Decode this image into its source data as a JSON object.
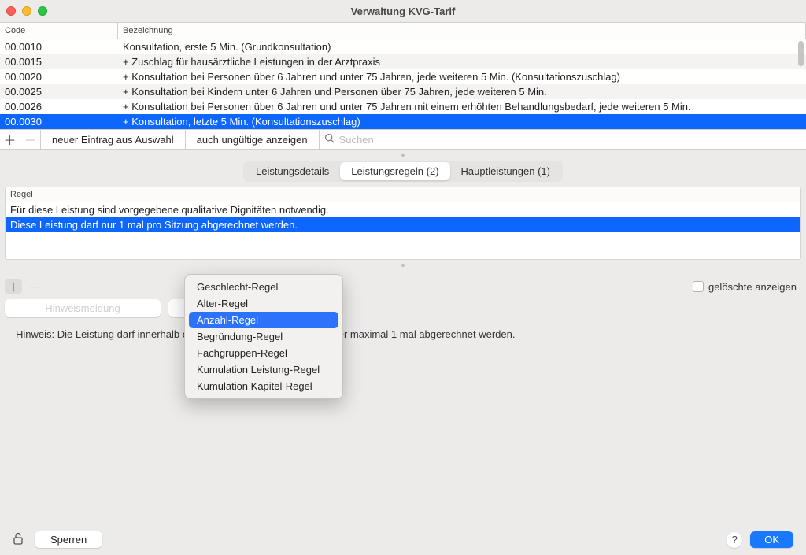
{
  "window": {
    "title": "Verwaltung KVG-Tarif"
  },
  "table": {
    "headers": {
      "code": "Code",
      "desc": "Bezeichnung"
    },
    "rows": [
      {
        "code": "00.0010",
        "desc": "Konsultation, erste 5 Min. (Grundkonsultation)"
      },
      {
        "code": "00.0015",
        "desc": "+ Zuschlag für hausärztliche Leistungen in der Arztpraxis"
      },
      {
        "code": "00.0020",
        "desc": "+ Konsultation bei Personen über 6 Jahren und unter 75 Jahren, jede weiteren 5 Min. (Konsultationszuschlag)"
      },
      {
        "code": "00.0025",
        "desc": "+ Konsultation bei Kindern unter 6 Jahren und Personen über 75 Jahren, jede weiteren 5 Min."
      },
      {
        "code": "00.0026",
        "desc": "+ Konsultation bei Personen über 6 Jahren und unter 75 Jahren mit einem erhöhten Behandlungsbedarf, jede weiteren 5 Min."
      },
      {
        "code": "00.0030",
        "desc": "+ Konsultation, letzte 5 Min. (Konsultationszuschlag)"
      }
    ],
    "selected_index": 5
  },
  "actionbar": {
    "new_from_selection": "neuer Eintrag aus Auswahl",
    "show_invalid": "auch ungültige anzeigen",
    "search_placeholder": "Suchen"
  },
  "tabs": {
    "details": "Leistungsdetails",
    "rules": "Leistungsregeln (2)",
    "main": "Hauptleistungen (1)",
    "active": "rules"
  },
  "rules": {
    "header": "Regel",
    "rows": [
      "Für diese Leistung sind vorgegebene qualitative Dignitäten notwendig.",
      "Diese Leistung darf nur 1 mal pro Sitzung abgerechnet werden."
    ],
    "selected_index": 1,
    "show_deleted_label": "gelöschte anzeigen",
    "hint_button": "Hinweismeldung",
    "hint_text": "Hinweis: Die Leistung darf innerhalb einer Sitzung pro Leistungserbringer maximal 1 mal abgerechnet werden."
  },
  "context_menu": {
    "items": [
      "Geschlecht-Regel",
      "Alter-Regel",
      "Anzahl-Regel",
      "Begründung-Regel",
      "Fachgruppen-Regel",
      "Kumulation Leistung-Regel",
      "Kumulation Kapitel-Regel"
    ],
    "selected_index": 2
  },
  "footer": {
    "lock_label": "Sperren",
    "ok": "OK",
    "help": "?"
  }
}
